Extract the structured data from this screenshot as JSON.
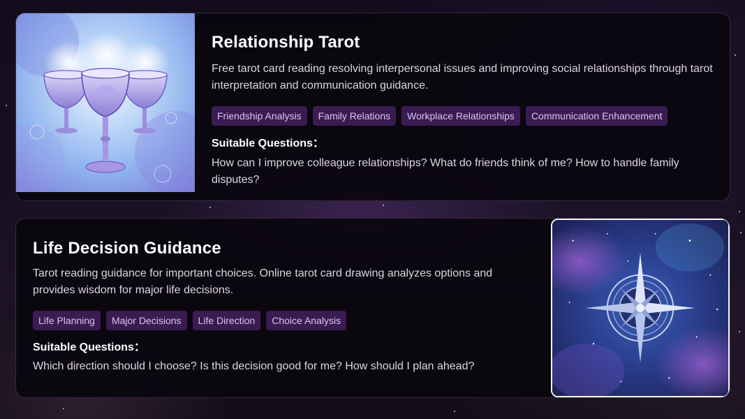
{
  "cards": [
    {
      "title": "Relationship Tarot",
      "description": "Free tarot card reading resolving interpersonal issues and improving social relationships through tarot interpretation and communication guidance.",
      "image": "three-chalices-illustration",
      "tags": [
        "Friendship Analysis",
        "Family Relations",
        "Workplace Relationships",
        "Communication Enhancement"
      ],
      "questions_label": "Suitable Questions：",
      "questions_text": "How can I improve colleague relationships? What do friends think of me? How to handle family disputes?"
    },
    {
      "title": "Life Decision Guidance",
      "description": "Tarot reading guidance for important choices. Online tarot card drawing analyzes options and provides wisdom for major life decisions.",
      "image": "compass-star-illustration",
      "tags": [
        "Life Planning",
        "Major Decisions",
        "Life Direction",
        "Choice Analysis"
      ],
      "questions_label": "Suitable Questions：",
      "questions_text": "Which direction should I choose? Is this decision good for me? How should I plan ahead?"
    }
  ],
  "colors": {
    "background": "#160f1f",
    "card_background": "#0a060e",
    "tag_background": "#3a1b52",
    "tag_text": "#d8c6ef",
    "text_primary": "#ffffff",
    "text_secondary": "#dcd7e2"
  }
}
